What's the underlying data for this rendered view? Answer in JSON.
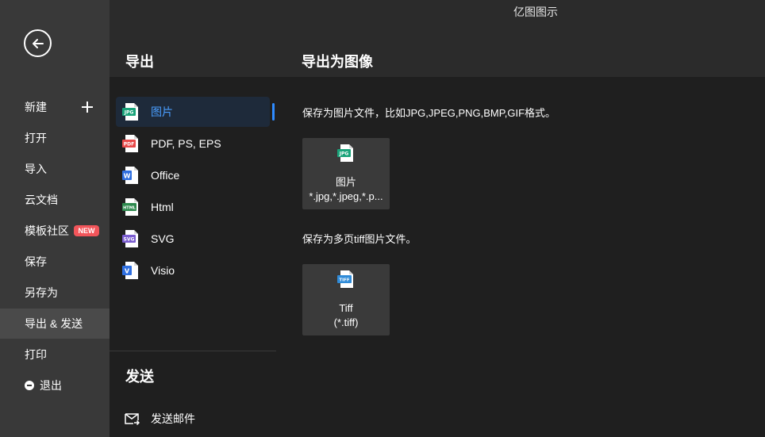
{
  "app": {
    "title": "亿图图示"
  },
  "nav": {
    "items": [
      {
        "label": "新建"
      },
      {
        "label": "打开"
      },
      {
        "label": "导入"
      },
      {
        "label": "云文档"
      },
      {
        "label": "模板社区",
        "badge": "NEW"
      },
      {
        "label": "保存"
      },
      {
        "label": "另存为"
      },
      {
        "label": "导出 & 发送"
      },
      {
        "label": "打印"
      },
      {
        "label": "退出"
      }
    ],
    "active_index": 7
  },
  "export": {
    "heading": "导出",
    "formats": [
      {
        "label": "图片",
        "icon": "jpg-file-icon",
        "tag": "JPG",
        "color": "#1aa37a"
      },
      {
        "label": "PDF, PS, EPS",
        "icon": "pdf-file-icon",
        "tag": "PDF",
        "color": "#e84a4a"
      },
      {
        "label": "Office",
        "icon": "word-file-icon",
        "tag": "W",
        "color": "#2f6fe0"
      },
      {
        "label": "Html",
        "icon": "html-file-icon",
        "tag": "HTML",
        "color": "#2d8a4e"
      },
      {
        "label": "SVG",
        "icon": "svg-file-icon",
        "tag": "SVG",
        "color": "#7a5ccf"
      },
      {
        "label": "Visio",
        "icon": "visio-file-icon",
        "tag": "V",
        "color": "#2f6fe0"
      }
    ]
  },
  "send": {
    "heading": "发送",
    "mail_label": "发送邮件"
  },
  "panel": {
    "title": "导出为图像",
    "image_desc": "保存为图片文件，比如JPG,JPEG,PNG,BMP,GIF格式。",
    "image_tile": {
      "title": "图片",
      "subtitle": "*.jpg,*.jpeg,*.p...",
      "tag": "JPG"
    },
    "tiff_desc": "保存为多页tiff图片文件。",
    "tiff_tile": {
      "title": "Tiff",
      "subtitle": "(*.tiff)",
      "tag": "TIFF"
    }
  },
  "colors": {
    "nav_bg": "#393939",
    "nav_active": "#4a4a4a",
    "list_bg": "#1f1f1f",
    "accent": "#2f8bff",
    "badge": "#f2555a"
  }
}
